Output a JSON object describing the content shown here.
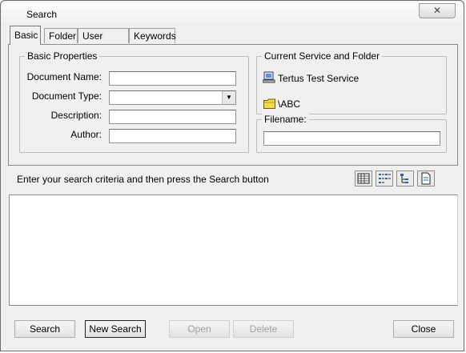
{
  "window": {
    "title": "Search",
    "close_glyph": "✕"
  },
  "tabs": [
    {
      "label": "Basic",
      "active": true
    },
    {
      "label": "Folder",
      "active": false
    },
    {
      "label": "User Fields",
      "active": false
    },
    {
      "label": "Keywords",
      "active": false
    }
  ],
  "basic_properties": {
    "legend": "Basic Properties",
    "document_name_label": "Document Name:",
    "document_name_value": "",
    "document_type_label": "Document Type:",
    "document_type_value": "",
    "description_label": "Description:",
    "description_value": "",
    "author_label": "Author:",
    "author_value": ""
  },
  "current_service": {
    "legend": "Current Service and Folder",
    "service_name": "Tertus Test Service",
    "service_icon": "computer-icon",
    "folder_name": "\\ABC",
    "folder_icon": "folder-icon"
  },
  "filename": {
    "legend": "Filename:",
    "value": ""
  },
  "hint": {
    "text": "Enter your search criteria and then press the Search button"
  },
  "view_buttons": [
    "details-view-icon",
    "list-view-icon",
    "tree-view-icon",
    "preview-icon"
  ],
  "buttons": {
    "search": "Search",
    "new_search": "New Search",
    "open": "Open",
    "delete": "Delete",
    "close": "Close"
  },
  "colors": {
    "folder": "#f5d94a",
    "window_bg": "#f0f0f0"
  }
}
